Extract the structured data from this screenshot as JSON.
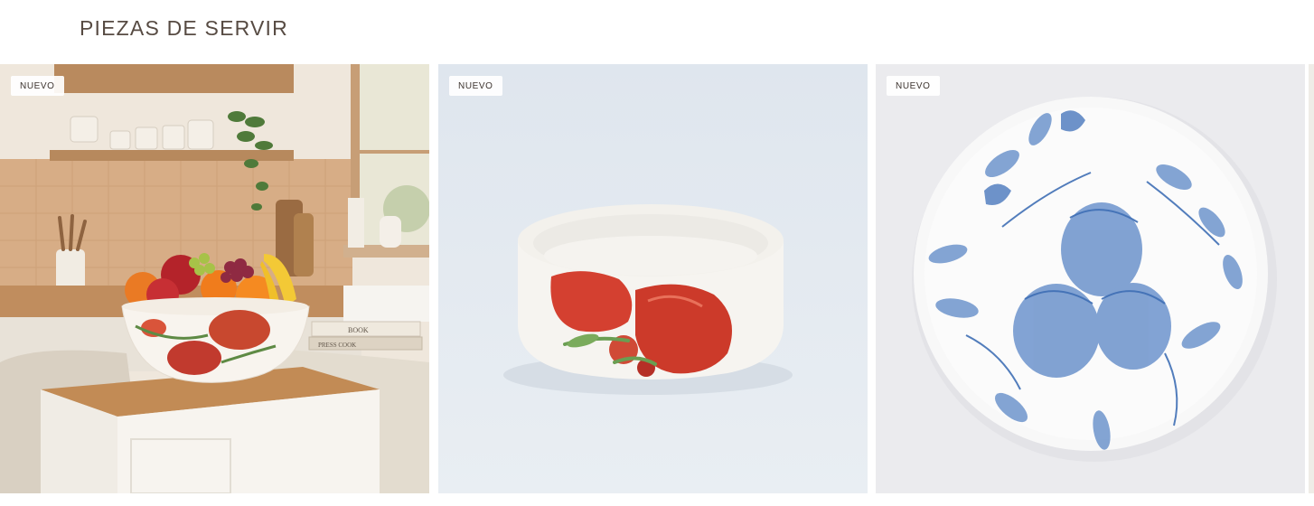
{
  "section": {
    "title": "PIEZAS DE SERVIR"
  },
  "products": [
    {
      "badge": "NUEVO",
      "image": "fruit bowl with pomegranate pattern on kitchen counter"
    },
    {
      "badge": "NUEVO",
      "image": "white serving bowl with red pomegranate illustration"
    },
    {
      "badge": "NUEVO",
      "image": "round plate with blue pomegranate botanical print"
    }
  ],
  "book_labels": [
    "BOOK",
    "PRESS COOK"
  ]
}
